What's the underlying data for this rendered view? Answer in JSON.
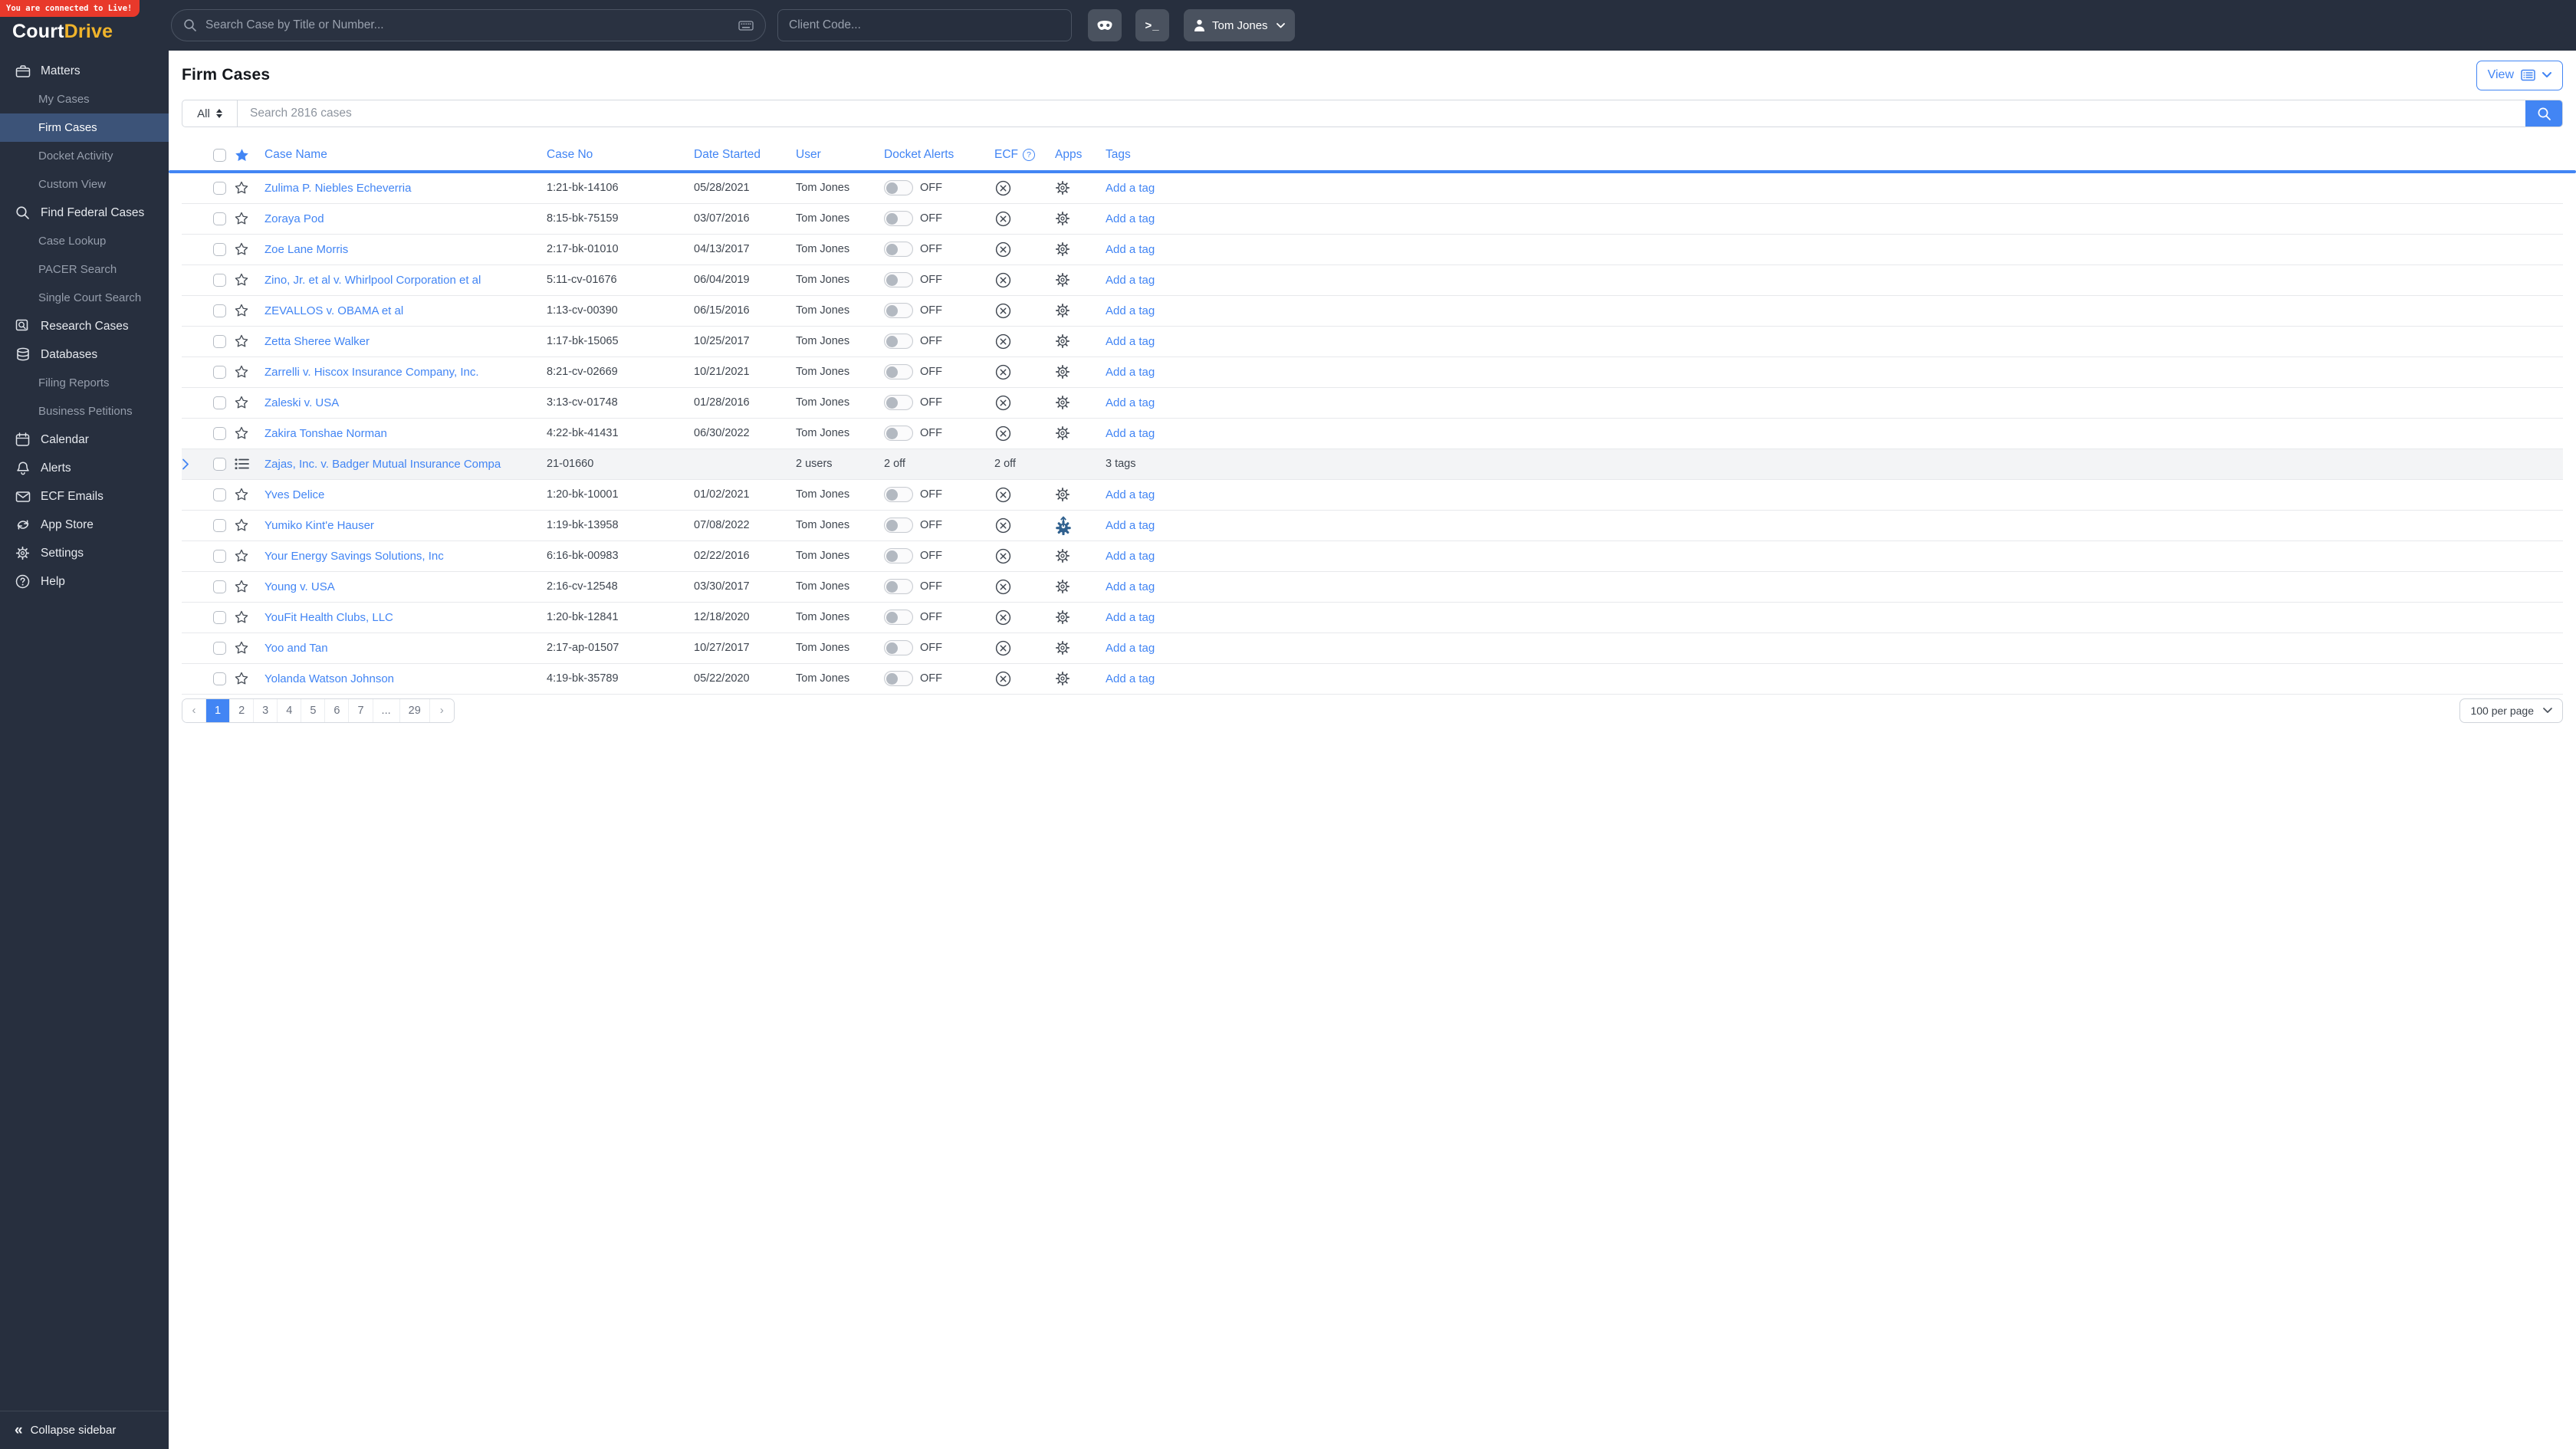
{
  "colors": {
    "accent": "#4285f4",
    "sidebar_bg": "#272f3e",
    "banner_red": "#e8392b",
    "logo_gold": "#f0b42b",
    "active_item_bg": "#3c5378"
  },
  "banner": {
    "text": "You are connected to Live!"
  },
  "logo": {
    "part1": "Court",
    "part2": "Drive"
  },
  "topbar": {
    "case_search_placeholder": "Search Case by Title or Number...",
    "client_code_placeholder": "Client Code...",
    "user_name": "Tom Jones"
  },
  "sidebar": {
    "items": [
      {
        "label": "Matters",
        "icon": "briefcase",
        "type": "section",
        "active": false
      },
      {
        "label": "My Cases",
        "icon": "",
        "type": "sub",
        "active": false
      },
      {
        "label": "Firm Cases",
        "icon": "",
        "type": "sub",
        "active": true
      },
      {
        "label": "Docket Activity",
        "icon": "",
        "type": "sub",
        "active": false
      },
      {
        "label": "Custom View",
        "icon": "",
        "type": "sub",
        "active": false
      },
      {
        "label": "Find Federal Cases",
        "icon": "search",
        "type": "section",
        "active": false
      },
      {
        "label": "Case Lookup",
        "icon": "",
        "type": "sub",
        "active": false
      },
      {
        "label": "PACER Search",
        "icon": "",
        "type": "sub",
        "active": false
      },
      {
        "label": "Single Court Search",
        "icon": "",
        "type": "sub",
        "active": false
      },
      {
        "label": "Research Cases",
        "icon": "docsearch",
        "type": "section",
        "active": false
      },
      {
        "label": "Databases",
        "icon": "database",
        "type": "section",
        "active": false
      },
      {
        "label": "Filing Reports",
        "icon": "",
        "type": "sub",
        "active": false
      },
      {
        "label": "Business Petitions",
        "icon": "",
        "type": "sub",
        "active": false
      },
      {
        "label": "Calendar",
        "icon": "calendar",
        "type": "section",
        "active": false
      },
      {
        "label": "Alerts",
        "icon": "bell",
        "type": "section",
        "active": false
      },
      {
        "label": "ECF Emails",
        "icon": "envelope",
        "type": "section",
        "active": false
      },
      {
        "label": "App Store",
        "icon": "sync",
        "type": "section",
        "active": false
      },
      {
        "label": "Settings",
        "icon": "gear",
        "type": "section",
        "active": false
      },
      {
        "label": "Help",
        "icon": "help",
        "type": "section",
        "active": false
      }
    ],
    "collapse_label": "Collapse sidebar"
  },
  "main": {
    "title": "Firm Cases",
    "view_button_label": "View",
    "filter": {
      "all_label": "All",
      "search_placeholder": "Search 2816 cases"
    },
    "table": {
      "headers": {
        "case_name": "Case Name",
        "case_no": "Case No",
        "date_started": "Date Started",
        "user": "User",
        "docket_alerts": "Docket Alerts",
        "ecf": "ECF",
        "apps": "Apps",
        "tags": "Tags"
      },
      "rows": [
        {
          "type": "case",
          "name": "Zulima P. Niebles Echeverria",
          "case_no": "1:21-bk-14106",
          "date": "05/28/2021",
          "user": "Tom Jones",
          "docket": "OFF",
          "ecf": "",
          "apps": "gear",
          "tags": "Add a tag"
        },
        {
          "type": "case",
          "name": "Zoraya Pod",
          "case_no": "8:15-bk-75159",
          "date": "03/07/2016",
          "user": "Tom Jones",
          "docket": "OFF",
          "ecf": "",
          "apps": "gear",
          "tags": "Add a tag"
        },
        {
          "type": "case",
          "name": "Zoe Lane Morris",
          "case_no": "2:17-bk-01010",
          "date": "04/13/2017",
          "user": "Tom Jones",
          "docket": "OFF",
          "ecf": "",
          "apps": "gear",
          "tags": "Add a tag"
        },
        {
          "type": "case",
          "name": "Zino, Jr. et al v. Whirlpool Corporation et al",
          "case_no": "5:11-cv-01676",
          "date": "06/04/2019",
          "user": "Tom Jones",
          "docket": "OFF",
          "ecf": "",
          "apps": "gear",
          "tags": "Add a tag"
        },
        {
          "type": "case",
          "name": "ZEVALLOS v. OBAMA et al",
          "case_no": "1:13-cv-00390",
          "date": "06/15/2016",
          "user": "Tom Jones",
          "docket": "OFF",
          "ecf": "",
          "apps": "gear",
          "tags": "Add a tag"
        },
        {
          "type": "case",
          "name": "Zetta Sheree Walker",
          "case_no": "1:17-bk-15065",
          "date": "10/25/2017",
          "user": "Tom Jones",
          "docket": "OFF",
          "ecf": "",
          "apps": "gear",
          "tags": "Add a tag"
        },
        {
          "type": "case",
          "name": "Zarrelli v. Hiscox Insurance Company, Inc.",
          "case_no": "8:21-cv-02669",
          "date": "10/21/2021",
          "user": "Tom Jones",
          "docket": "OFF",
          "ecf": "",
          "apps": "gear",
          "tags": "Add a tag"
        },
        {
          "type": "case",
          "name": "Zaleski v. USA",
          "case_no": "3:13-cv-01748",
          "date": "01/28/2016",
          "user": "Tom Jones",
          "docket": "OFF",
          "ecf": "",
          "apps": "gear",
          "tags": "Add a tag"
        },
        {
          "type": "case",
          "name": "Zakira Tonshae Norman",
          "case_no": "4:22-bk-41431",
          "date": "06/30/2022",
          "user": "Tom Jones",
          "docket": "OFF",
          "ecf": "",
          "apps": "gear",
          "tags": "Add a tag"
        },
        {
          "type": "group",
          "name": "Zajas, Inc. v. Badger Mutual Insurance Compa",
          "case_no": "21-01660",
          "date": "",
          "user": "2 users",
          "docket": "2 off",
          "ecf": "2 off",
          "apps": "",
          "tags": "3 tags"
        },
        {
          "type": "case",
          "name": "Yves Delice",
          "case_no": "1:20-bk-10001",
          "date": "01/02/2021",
          "user": "Tom Jones",
          "docket": "OFF",
          "ecf": "",
          "apps": "gear",
          "tags": "Add a tag"
        },
        {
          "type": "case",
          "name": "Yumiko Kint'e Hauser",
          "case_no": "1:19-bk-13958",
          "date": "07/08/2022",
          "user": "Tom Jones",
          "docket": "OFF",
          "ecf": "",
          "apps": "gear-update",
          "tags": "Add a tag"
        },
        {
          "type": "case",
          "name": "Your Energy Savings Solutions, Inc",
          "case_no": "6:16-bk-00983",
          "date": "02/22/2016",
          "user": "Tom Jones",
          "docket": "OFF",
          "ecf": "",
          "apps": "gear",
          "tags": "Add a tag"
        },
        {
          "type": "case",
          "name": "Young v. USA",
          "case_no": "2:16-cv-12548",
          "date": "03/30/2017",
          "user": "Tom Jones",
          "docket": "OFF",
          "ecf": "",
          "apps": "gear",
          "tags": "Add a tag"
        },
        {
          "type": "case",
          "name": "YouFit Health Clubs, LLC",
          "case_no": "1:20-bk-12841",
          "date": "12/18/2020",
          "user": "Tom Jones",
          "docket": "OFF",
          "ecf": "",
          "apps": "gear",
          "tags": "Add a tag"
        },
        {
          "type": "case",
          "name": "Yoo and Tan",
          "case_no": "2:17-ap-01507",
          "date": "10/27/2017",
          "user": "Tom Jones",
          "docket": "OFF",
          "ecf": "",
          "apps": "gear",
          "tags": "Add a tag"
        },
        {
          "type": "case",
          "name": "Yolanda Watson Johnson",
          "case_no": "4:19-bk-35789",
          "date": "05/22/2020",
          "user": "Tom Jones",
          "docket": "OFF",
          "ecf": "",
          "apps": "gear",
          "tags": "Add a tag"
        }
      ]
    },
    "pagination": {
      "prev": "‹",
      "pages": [
        "1",
        "2",
        "3",
        "4",
        "5",
        "6",
        "7",
        "...",
        "29"
      ],
      "active": "1",
      "next": "›"
    },
    "per_page_label": "100 per page"
  }
}
